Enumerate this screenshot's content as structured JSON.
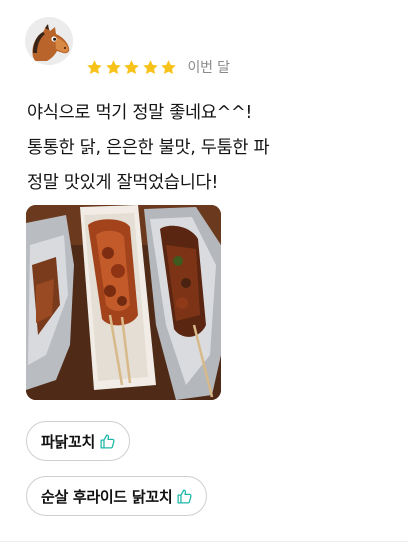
{
  "review": {
    "rating": 5,
    "rating_max": 5,
    "star_color": "#F7C21A",
    "date": "이번 달",
    "body_lines": [
      "야식으로 먹기 정말 좋네요^^!",
      "통통한 닭, 은은한 불맛, 두툼한 파",
      "정말 맛있게 잘먹었습니다!"
    ]
  },
  "tags": [
    {
      "label": "파닭꼬치",
      "icon": "thumbs-up-icon"
    },
    {
      "label": "순살 후라이드 닭꼬치",
      "icon": "thumbs-up-icon"
    }
  ],
  "accent_color": "#1FB8A8"
}
